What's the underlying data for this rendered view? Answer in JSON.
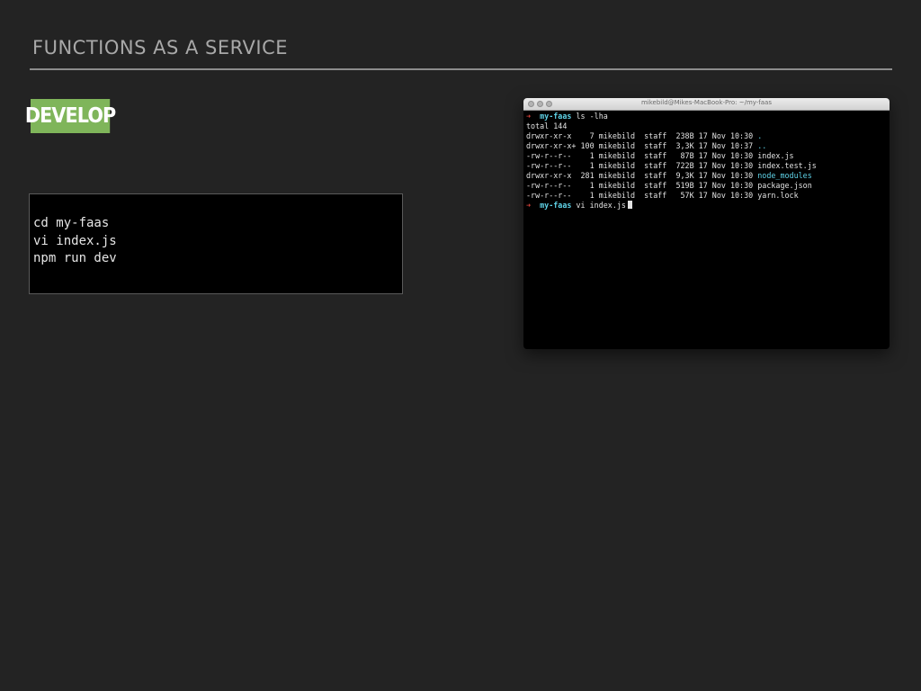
{
  "slide": {
    "title": "FUNCTIONS AS A SERVICE",
    "badge": "DEVELOP"
  },
  "code_box": {
    "lines": [
      "cd my-faas",
      "vi index.js",
      "npm run dev"
    ]
  },
  "terminal": {
    "window_title": "mikebild@Mikes-MacBook-Pro: ~/my-faas",
    "prompt_arrow": "➜",
    "prompt_dir": "my-faas",
    "command1": "ls -lha",
    "total": "total 144",
    "listing": [
      {
        "perms": "drwxr-xr-x ",
        "links": "  7",
        "owner": "mikebild",
        "group": "staff",
        "size": " 238B",
        "date": "17 Nov 10:30",
        "name": ".",
        "is_dir": true
      },
      {
        "perms": "drwxr-xr-x+",
        "links": "100",
        "owner": "mikebild",
        "group": "staff",
        "size": " 3,3K",
        "date": "17 Nov 10:37",
        "name": "..",
        "is_dir": true
      },
      {
        "perms": "-rw-r--r-- ",
        "links": "  1",
        "owner": "mikebild",
        "group": "staff",
        "size": "  87B",
        "date": "17 Nov 10:30",
        "name": "index.js",
        "is_dir": false
      },
      {
        "perms": "-rw-r--r-- ",
        "links": "  1",
        "owner": "mikebild",
        "group": "staff",
        "size": " 722B",
        "date": "17 Nov 10:30",
        "name": "index.test.js",
        "is_dir": false
      },
      {
        "perms": "drwxr-xr-x ",
        "links": "281",
        "owner": "mikebild",
        "group": "staff",
        "size": " 9,3K",
        "date": "17 Nov 10:30",
        "name": "node_modules",
        "is_dir": true
      },
      {
        "perms": "-rw-r--r-- ",
        "links": "  1",
        "owner": "mikebild",
        "group": "staff",
        "size": " 519B",
        "date": "17 Nov 10:30",
        "name": "package.json",
        "is_dir": false
      },
      {
        "perms": "-rw-r--r-- ",
        "links": "  1",
        "owner": "mikebild",
        "group": "staff",
        "size": "  57K",
        "date": "17 Nov 10:30",
        "name": "yarn.lock",
        "is_dir": false
      }
    ],
    "command2": "vi index.js"
  },
  "colors": {
    "background": "#232323",
    "badge_green": "#7fb55a",
    "prompt_arrow_red": "#e0453c",
    "dir_cyan": "#5fd3e8"
  }
}
